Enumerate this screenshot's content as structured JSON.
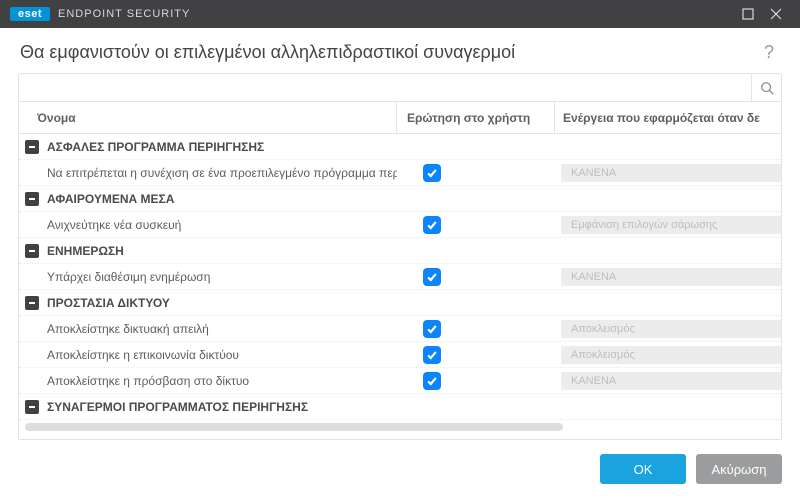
{
  "titlebar": {
    "brand": "eset",
    "product": "ENDPOINT SECURITY"
  },
  "heading": "Θα εμφανιστούν οι επιλεγμένοι αλληλεπιδραστικοί συναγερμοί",
  "columns": {
    "name": "Όνομα",
    "ask": "Ερώτηση στο χρήστη",
    "action": "Ενέργεια που εφαρμόζεται όταν δε"
  },
  "groups": [
    {
      "label": "ΑΣΦΑΛΕΣ ΠΡΟΓΡΑΜΜΑ ΠΕΡΙΗΓΗΣΗΣ",
      "items": [
        {
          "label": "Να επιτρέπεται η συνέχιση σε ένα προεπιλεγμένο πρόγραμμα περ",
          "action": "ΚΑΝΕΝΑ"
        }
      ]
    },
    {
      "label": "ΑΦΑΙΡΟΥΜΕΝΑ ΜΕΣΑ",
      "items": [
        {
          "label": "Ανιχνεύτηκε νέα συσκευή",
          "action": "Εμφάνιση επιλογών σάρωσης"
        }
      ]
    },
    {
      "label": "ΕΝΗΜΕΡΩΣΗ",
      "items": [
        {
          "label": "Υπάρχει διαθέσιμη ενημέρωση",
          "action": "ΚΑΝΕΝΑ"
        }
      ]
    },
    {
      "label": "ΠΡΟΣΤΑΣΙΑ ΔΙΚΤΥΟΥ",
      "items": [
        {
          "label": "Αποκλείστηκε δικτυακή απειλή",
          "action": "Αποκλεισμός"
        },
        {
          "label": "Αποκλείστηκε η επικοινωνία δικτύου",
          "action": "Αποκλεισμός"
        },
        {
          "label": "Αποκλείστηκε η πρόσβαση στο δίκτυο",
          "action": "ΚΑΝΕΝΑ"
        }
      ]
    },
    {
      "label": "ΣΥΝΑΓΕΡΜΟΙ ΠΡΟΓΡΑΜΜΑΤΟΣ ΠΕΡΙΗΓΗΣΗΣ",
      "items": []
    }
  ],
  "footer": {
    "ok": "OK",
    "cancel": "Ακύρωση"
  }
}
